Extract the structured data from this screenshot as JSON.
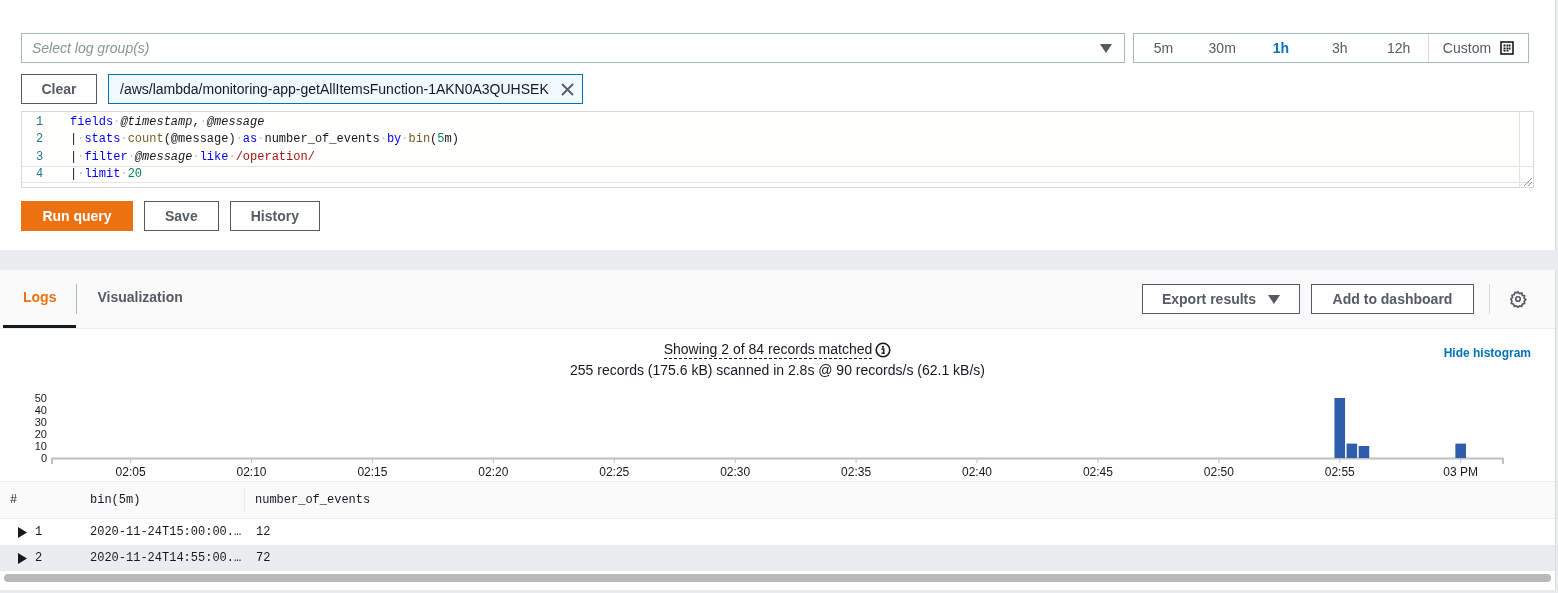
{
  "query_panel": {
    "log_group_select": {
      "placeholder": "Select log group(s)"
    },
    "time_ranges": [
      {
        "label": "5m",
        "selected": false
      },
      {
        "label": "30m",
        "selected": false
      },
      {
        "label": "1h",
        "selected": true
      },
      {
        "label": "3h",
        "selected": false
      },
      {
        "label": "12h",
        "selected": false
      }
    ],
    "custom_range": {
      "label": "Custom"
    },
    "clear_button": "Clear",
    "selected_log_groups": [
      {
        "label": "/aws/lambda/monitoring-app-getAllItemsFunction-1AKN0A3QUHSEK"
      }
    ],
    "editor": {
      "lines": [
        {
          "number": "1",
          "tokens": [
            {
              "kind": "keyword",
              "text": "fields"
            },
            {
              "kind": "space",
              "text": "·"
            },
            {
              "kind": "field",
              "text": "@timestamp"
            },
            {
              "kind": "plain",
              "text": ","
            },
            {
              "kind": "space",
              "text": "·"
            },
            {
              "kind": "field",
              "text": "@message"
            }
          ]
        },
        {
          "number": "2",
          "tokens": [
            {
              "kind": "plain",
              "text": "|"
            },
            {
              "kind": "space",
              "text": "·"
            },
            {
              "kind": "keyword",
              "text": "stats"
            },
            {
              "kind": "space",
              "text": "·"
            },
            {
              "kind": "function",
              "text": "count"
            },
            {
              "kind": "plain",
              "text": "(@message)"
            },
            {
              "kind": "space",
              "text": "·"
            },
            {
              "kind": "keyword",
              "text": "as"
            },
            {
              "kind": "space",
              "text": "·"
            },
            {
              "kind": "plain",
              "text": "number_of_events"
            },
            {
              "kind": "space",
              "text": "·"
            },
            {
              "kind": "keyword",
              "text": "by"
            },
            {
              "kind": "space",
              "text": "·"
            },
            {
              "kind": "function",
              "text": "bin"
            },
            {
              "kind": "plain",
              "text": "("
            },
            {
              "kind": "number",
              "text": "5"
            },
            {
              "kind": "plain",
              "text": "m)"
            }
          ]
        },
        {
          "number": "3",
          "tokens": [
            {
              "kind": "plain",
              "text": "|"
            },
            {
              "kind": "space",
              "text": "·"
            },
            {
              "kind": "keyword",
              "text": "filter"
            },
            {
              "kind": "space",
              "text": "·"
            },
            {
              "kind": "field",
              "text": "@message"
            },
            {
              "kind": "space",
              "text": "·"
            },
            {
              "kind": "keyword",
              "text": "like"
            },
            {
              "kind": "space",
              "text": "·"
            },
            {
              "kind": "regex",
              "text": "/operation/"
            }
          ]
        },
        {
          "number": "4",
          "tokens": [
            {
              "kind": "plain",
              "text": "|"
            },
            {
              "kind": "space",
              "text": "·"
            },
            {
              "kind": "keyword",
              "text": "limit"
            },
            {
              "kind": "space",
              "text": "·"
            },
            {
              "kind": "number",
              "text": "20"
            }
          ]
        }
      ]
    },
    "buttons": [
      {
        "label": "Run query",
        "kind": "primary"
      },
      {
        "label": "Save",
        "kind": "normal"
      },
      {
        "label": "History",
        "kind": "normal"
      }
    ]
  },
  "results_panel": {
    "tabs": [
      {
        "label": "Logs",
        "selected": true
      },
      {
        "label": "Visualization",
        "selected": false
      }
    ],
    "export_button": "Export results",
    "dashboard_button": "Add to dashboard",
    "summary": "Showing 2 of 84 records matched",
    "scan_stats": "255 records (175.6 kB) scanned in 2.8s @ 90 records/s (62.1 kB/s)",
    "hide_histogram_link": "Hide histogram",
    "histogram": {
      "chart_data": {
        "type": "bar",
        "ylim": [
          0,
          50
        ],
        "yticks": [
          0,
          10,
          20,
          30,
          40,
          50
        ],
        "categories": [
          null,
          null,
          null,
          null,
          null,
          null,
          "02:05",
          null,
          null,
          null,
          null,
          null,
          null,
          null,
          null,
          null,
          "02:10",
          null,
          null,
          null,
          null,
          null,
          null,
          null,
          null,
          null,
          "02:15",
          null,
          null,
          null,
          null,
          null,
          null,
          null,
          null,
          null,
          "02:20",
          null,
          null,
          null,
          null,
          null,
          null,
          null,
          null,
          null,
          "02:25",
          null,
          null,
          null,
          null,
          null,
          null,
          null,
          null,
          null,
          "02:30",
          null,
          null,
          null,
          null,
          null,
          null,
          null,
          null,
          null,
          "02:35",
          null,
          null,
          null,
          null,
          null,
          null,
          null,
          null,
          null,
          "02:40",
          null,
          null,
          null,
          null,
          null,
          null,
          null,
          null,
          null,
          "02:45",
          null,
          null,
          null,
          null,
          null,
          null,
          null,
          null,
          null,
          "02:50",
          null,
          null,
          null,
          null,
          null,
          null,
          null,
          null,
          null,
          "02:55",
          null,
          null,
          null,
          null,
          null,
          null,
          null,
          null,
          null,
          "03 PM",
          null,
          null,
          null
        ],
        "series": [
          {
            "color": "#2e5eaa",
            "values": [
              null,
              null,
              null,
              null,
              null,
              null,
              null,
              null,
              null,
              null,
              null,
              null,
              null,
              null,
              null,
              null,
              null,
              null,
              null,
              null,
              null,
              null,
              null,
              null,
              null,
              null,
              null,
              null,
              null,
              null,
              null,
              null,
              null,
              null,
              null,
              null,
              null,
              null,
              null,
              null,
              null,
              null,
              null,
              null,
              null,
              null,
              null,
              null,
              null,
              null,
              null,
              null,
              null,
              null,
              null,
              null,
              null,
              null,
              null,
              null,
              null,
              null,
              null,
              null,
              null,
              null,
              null,
              null,
              null,
              null,
              null,
              null,
              null,
              null,
              null,
              null,
              null,
              null,
              null,
              null,
              null,
              null,
              null,
              null,
              null,
              null,
              null,
              null,
              null,
              null,
              null,
              null,
              null,
              null,
              null,
              null,
              null,
              null,
              null,
              null,
              null,
              null,
              null,
              null,
              null,
              null,
              50,
              12,
              10,
              null,
              null,
              null,
              null,
              null,
              null,
              null,
              12,
              null,
              null,
              null
            ]
          }
        ]
      }
    },
    "table": {
      "columns": [
        "#",
        "bin(5m)",
        "number_of_events"
      ],
      "rows": [
        {
          "index": "1",
          "bin": "2020-11-24T15:00:00.…",
          "count": "12",
          "selected": false
        },
        {
          "index": "2",
          "bin": "2020-11-24T14:55:00.…",
          "count": "72",
          "selected": true
        }
      ]
    }
  }
}
